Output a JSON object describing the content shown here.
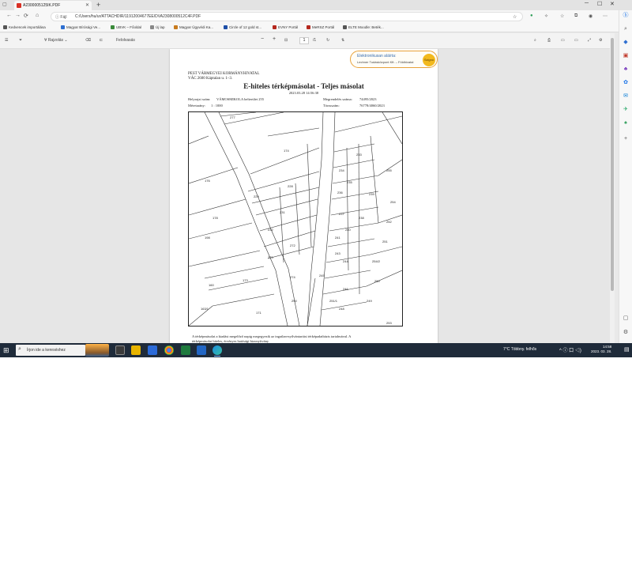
{
  "browser": {
    "tab_title": "A2300005125IK.PDF",
    "new_tab_symbol": "+",
    "window_controls": [
      "─",
      "☐",
      "✕"
    ],
    "nav": {
      "back": "←",
      "forward": "→",
      "refresh": "⟳",
      "home": "⌂"
    },
    "address_info": "ⓘ Fájl",
    "url": "C:/Users/hu/ur/ATTACHDIR/11912004677EE/DVA2308000512C4F.PDF",
    "favorites": [
      {
        "label": "Kedvencek importálása",
        "color": "#555555"
      },
      {
        "label": "Magyar Bírósági Ve...",
        "color": "#2e6fd1"
      },
      {
        "label": "UBVK – Főoldal",
        "color": "#3a8a3a"
      },
      {
        "label": "Új lap",
        "color": "#888888"
      },
      {
        "label": "Magyar Ügyvédi Ka...",
        "color": "#c87b1e"
      },
      {
        "label": "Circle of 12 gold st...",
        "color": "#1e4fa8"
      },
      {
        "label": "EVNY Portál",
        "color": "#b5281e"
      },
      {
        "label": "MeRSZ Portál",
        "color": "#b5281e"
      },
      {
        "label": "ELTE Moodle: Beték...",
        "color": "#555555"
      }
    ]
  },
  "pdf_toolbar": {
    "menu_icon": "☰",
    "filter_icon": "⏷",
    "draw_label": "Rajzolás",
    "erase_icon": "⌫",
    "read_aloud_label": "Felolvasás",
    "zoom_out": "−",
    "zoom_in": "+",
    "page_current": "1",
    "page_total": "/1"
  },
  "document": {
    "stamp_line1": "Elektronikusan aláírta:",
    "stamp_line2": "Lechner Tudásközpont Kft. – Földhivatal",
    "stamp_seal": "Szignó",
    "office_line1": "PEST VÁRMEGYEI KORMÁNYHIVATAL",
    "office_line2": "VÁC 2600 Káptalan u. 1–3.",
    "title": "E-hiteles térképmásolat - Teljes másolat",
    "date": "2023.03.28 14:56:38",
    "helyrajzi_label": "Helyrajzi szám:",
    "helyrajzi_value": "VÁMOSMIKOLA belterület 255",
    "megrendeles_label": "Megrendelés száma:",
    "megrendeles_value": "74495/2023",
    "meretarany_label": "Méretarány:",
    "meretarany_value": "1 : 1000",
    "torzsszam_label": "Törzsszám:",
    "torzsszam_value": "76778/4060/2023",
    "footer_line1": "A térképmásolat a kiadást megelőző napig megegyezik az ingatlan-nyilvántartási térképadatbázis tartalmával. A",
    "footer_line2": "térképmásolat hiteles, érvényes hatósági bizonyítvány"
  },
  "map_labels": [
    "277",
    "174",
    "176",
    "178",
    "198",
    "160",
    "171",
    "173",
    "228",
    "229",
    "231",
    "232",
    "233",
    "234",
    "235",
    "236",
    "237",
    "238",
    "239",
    "240",
    "241",
    "243",
    "244",
    "245",
    "246",
    "248",
    "249",
    "250",
    "251",
    "252",
    "253",
    "254",
    "255",
    "270",
    "272",
    "274",
    "290",
    "251/1",
    "254/2",
    "163/1"
  ],
  "taskbar": {
    "start_icon": "⊞",
    "search_placeholder": "Írjon ide a kereséshez",
    "weather": "7°C  Többny. felhős",
    "tray": "^ ⓘ 口 ◁)",
    "clock_time": "14:58",
    "clock_date": "2023. 03. 28."
  },
  "colors": {
    "taskbar": "#1f2b3a",
    "stamp_border": "#e8a23a",
    "accent": "#3b6fb0"
  }
}
